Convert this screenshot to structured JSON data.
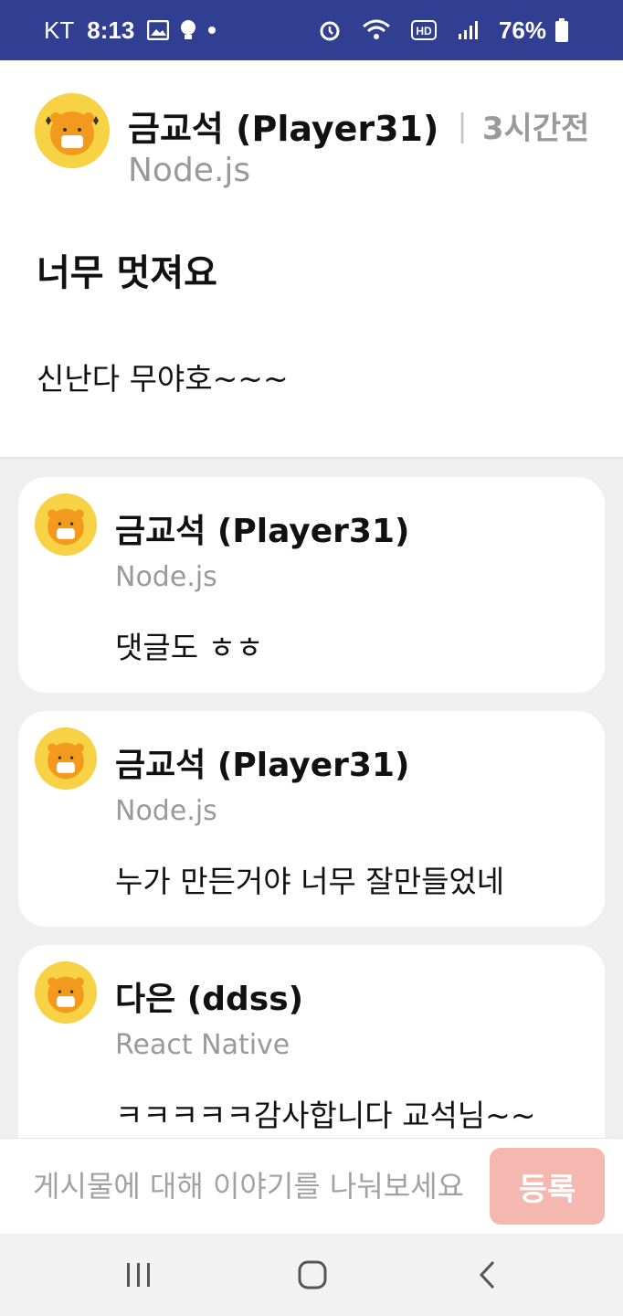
{
  "status_bar": {
    "carrier": "KT",
    "time": "8:13",
    "battery": "76%",
    "icons": [
      "image-icon",
      "bulb-icon",
      "dot-icon",
      "alarm-icon",
      "wifi-icon",
      "hd-icon",
      "signal-icon",
      "battery-icon"
    ],
    "bg_color": "#303f91"
  },
  "post": {
    "author": "금교석 (Player31)",
    "separator": "|",
    "time": "3시간전",
    "track": "Node.js",
    "title": "너무 멋져요",
    "body": "신난다 무야호~~~"
  },
  "comments": [
    {
      "author": "금교석 (Player31)",
      "track": "Node.js",
      "text": "댓글도 ㅎㅎ"
    },
    {
      "author": "금교석 (Player31)",
      "track": "Node.js",
      "text": "누가 만든거야 너무 잘만들었네"
    },
    {
      "author": "다은 (ddss)",
      "track": "React Native",
      "text": "ㅋㅋㅋㅋㅋ감사합니다 교석님~~"
    }
  ],
  "input": {
    "placeholder": "게시물에 대해 이야기를 나눠보세요",
    "value": ""
  },
  "submit_label": "등록",
  "colors": {
    "accent_disabled": "#f5b8b0",
    "avatar_bg": "#f7d245"
  }
}
